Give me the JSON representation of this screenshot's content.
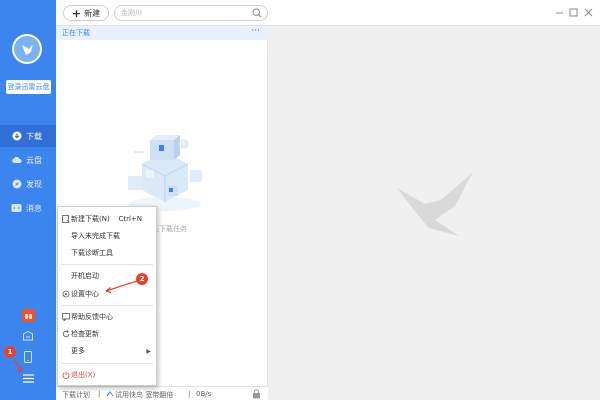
{
  "sidebar": {
    "login_button": "登录迅雷云盘",
    "items": [
      {
        "label": "下载",
        "icon": "download-icon"
      },
      {
        "label": "云盘",
        "icon": "cloud-icon"
      },
      {
        "label": "发现",
        "icon": "compass-icon"
      },
      {
        "label": "消息",
        "icon": "message-icon"
      }
    ],
    "bottom_icons": [
      "red-gift-icon",
      "box-icon",
      "phone-icon",
      "hamburger-menu-icon"
    ],
    "accent_color": "#3d85ee"
  },
  "toolbar": {
    "new_button": "新建",
    "search_placeholder": "金刚川"
  },
  "download_list": {
    "header": "正在下载",
    "more": "···",
    "empty_text": "暂无下载任务"
  },
  "footer": {
    "plan": "下载计划",
    "trial": "试用快鸟 宽带翻倍",
    "speed": "0B/s"
  },
  "context_menu": {
    "items": [
      {
        "label": "新建下载(N)",
        "shortcut": "Ctrl+N",
        "icon": "new-download-icon"
      },
      {
        "label": "导入未完成下载",
        "shortcut": "",
        "icon": ""
      },
      {
        "label": "下载诊断工具",
        "shortcut": "",
        "icon": ""
      },
      {
        "label": "开机启动",
        "shortcut": "",
        "icon": ""
      },
      {
        "label": "设置中心",
        "shortcut": "",
        "icon": "gear-icon"
      },
      {
        "label": "帮助反馈中心",
        "shortcut": "",
        "icon": "feedback-icon"
      },
      {
        "label": "检查更新",
        "shortcut": "",
        "icon": "refresh-icon"
      },
      {
        "label": "更多",
        "shortcut": "",
        "icon": ""
      },
      {
        "label": "退出(X)",
        "shortcut": "",
        "icon": "power-icon"
      }
    ]
  },
  "annotations": {
    "step1": "1",
    "step2": "2",
    "color": "#e8412f"
  }
}
